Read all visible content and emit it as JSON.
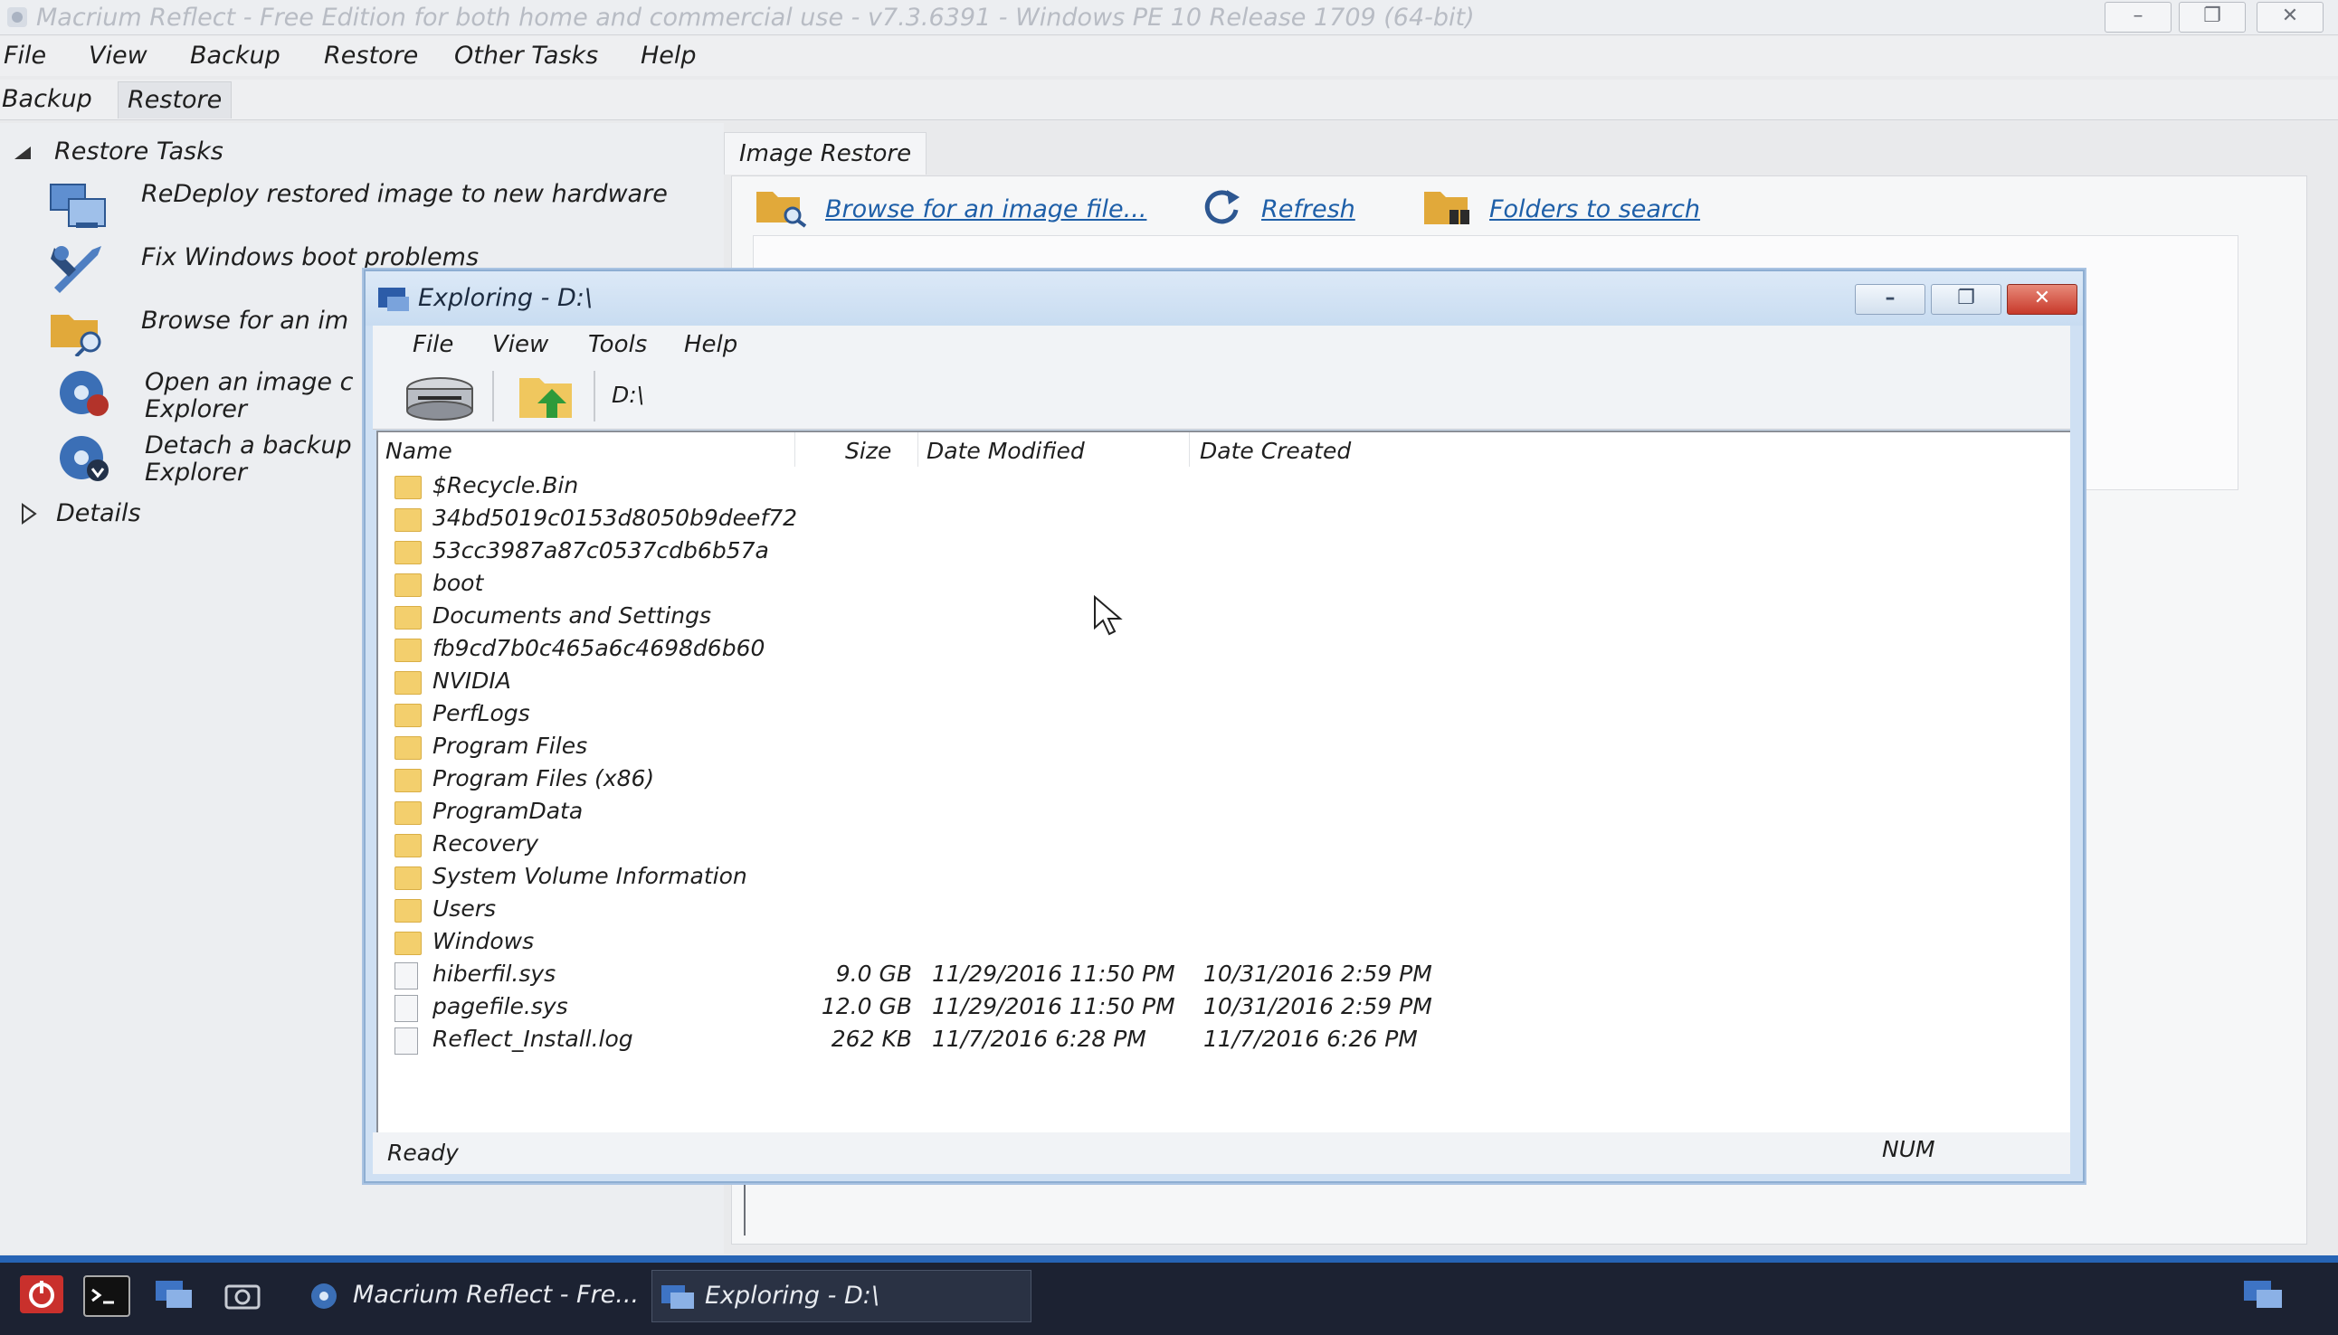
{
  "app": {
    "title": "Macrium Reflect - Free Edition for both home and commercial use - v7.3.6391 - Windows PE 10 Release 1709 (64-bit)",
    "window_controls": [
      "–",
      "❐",
      "✕"
    ]
  },
  "menu": [
    "File",
    "View",
    "Backup",
    "Restore",
    "Other Tasks",
    "Help"
  ],
  "tabs": [
    "Backup",
    "Restore"
  ],
  "restore_tasks": {
    "heading": "Restore Tasks",
    "items": [
      {
        "label": "ReDeploy restored image to new hardware",
        "icon": "redeploy-icon"
      },
      {
        "label": "Fix Windows boot problems",
        "icon": "fix-boot-icon"
      },
      {
        "label": "Browse for an im",
        "icon": "browse-folder-icon"
      },
      {
        "label": "Open an image c",
        "label2": "Explorer",
        "icon": "open-image-icon"
      },
      {
        "label": "Detach a backup",
        "label2": "Explorer",
        "icon": "detach-backup-icon"
      }
    ],
    "details": "Details"
  },
  "image_restore": {
    "tab": "Image Restore",
    "browse": "Browse for an image file...",
    "refresh": "Refresh",
    "folders": "Folders to search"
  },
  "explorer": {
    "title": "Exploring - D:\\",
    "menu": [
      "File",
      "View",
      "Tools",
      "Help"
    ],
    "path": "D:\\",
    "columns": {
      "name": "Name",
      "size": "Size",
      "modified": "Date Modified",
      "created": "Date Created"
    },
    "rows": [
      {
        "name": "$Recycle.Bin",
        "type": "folder",
        "size": "",
        "modified": "",
        "created": ""
      },
      {
        "name": "34bd5019c0153d8050b9deef72",
        "type": "folder",
        "size": "",
        "modified": "",
        "created": ""
      },
      {
        "name": "53cc3987a87c0537cdb6b57a",
        "type": "folder",
        "size": "",
        "modified": "",
        "created": ""
      },
      {
        "name": "boot",
        "type": "folder",
        "size": "",
        "modified": "",
        "created": ""
      },
      {
        "name": "Documents and Settings",
        "type": "folder",
        "size": "",
        "modified": "",
        "created": ""
      },
      {
        "name": "fb9cd7b0c465a6c4698d6b60",
        "type": "folder",
        "size": "",
        "modified": "",
        "created": ""
      },
      {
        "name": "NVIDIA",
        "type": "folder",
        "size": "",
        "modified": "",
        "created": ""
      },
      {
        "name": "PerfLogs",
        "type": "folder",
        "size": "",
        "modified": "",
        "created": ""
      },
      {
        "name": "Program Files",
        "type": "folder",
        "size": "",
        "modified": "",
        "created": ""
      },
      {
        "name": "Program Files (x86)",
        "type": "folder",
        "size": "",
        "modified": "",
        "created": ""
      },
      {
        "name": "ProgramData",
        "type": "folder",
        "size": "",
        "modified": "",
        "created": ""
      },
      {
        "name": "Recovery",
        "type": "folder",
        "size": "",
        "modified": "",
        "created": ""
      },
      {
        "name": "System Volume Information",
        "type": "folder",
        "size": "",
        "modified": "",
        "created": ""
      },
      {
        "name": "Users",
        "type": "folder",
        "size": "",
        "modified": "",
        "created": ""
      },
      {
        "name": "Windows",
        "type": "folder",
        "size": "",
        "modified": "",
        "created": ""
      },
      {
        "name": "hiberfil.sys",
        "type": "sysfile",
        "size": "9.0 GB",
        "modified": "11/29/2016 11:50 PM",
        "created": "10/31/2016 2:59 PM"
      },
      {
        "name": "pagefile.sys",
        "type": "sysfile",
        "size": "12.0 GB",
        "modified": "11/29/2016 11:50 PM",
        "created": "10/31/2016 2:59 PM"
      },
      {
        "name": "Reflect_Install.log",
        "type": "file",
        "size": "262 KB",
        "modified": "11/7/2016 6:28 PM",
        "created": "11/7/2016 6:26 PM"
      }
    ],
    "status": "Ready",
    "num": "NUM"
  },
  "taskbar": {
    "items": [
      "Macrium Reflect - Fre...",
      "Exploring - D:\\"
    ]
  },
  "colors": {
    "link": "#1e5fa8",
    "close_button": "#c7392a",
    "taskbar": "#1c2232",
    "taskbar_accent": "#2664b5"
  }
}
